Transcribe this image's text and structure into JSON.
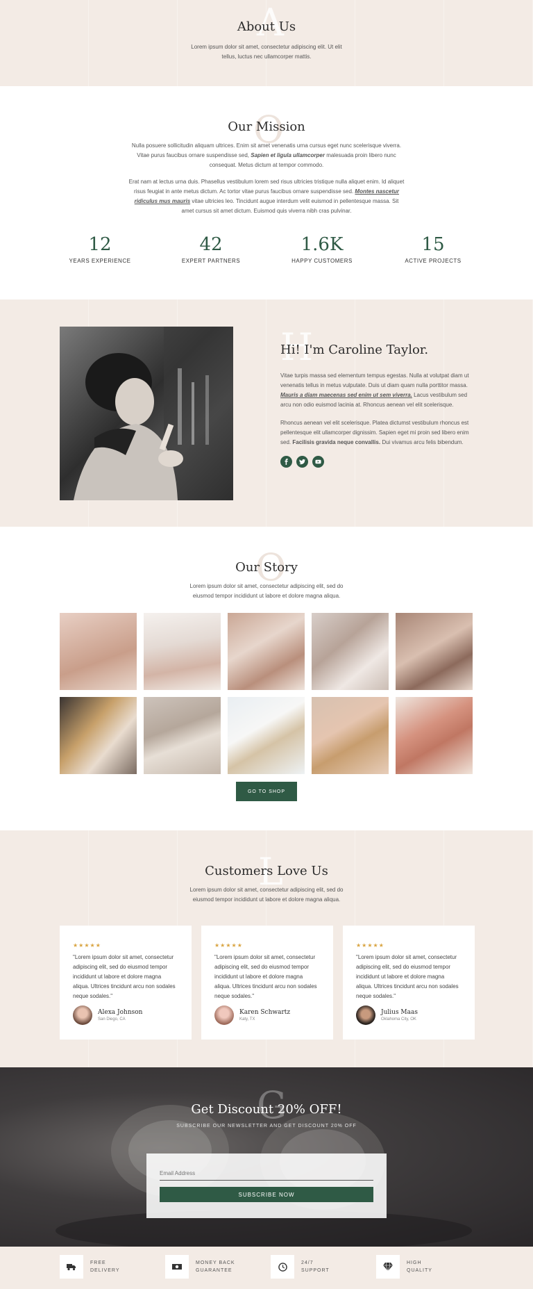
{
  "about": {
    "letter": "A",
    "title": "About Us",
    "text": "Lorem ipsum dolor sit amet, consectetur adipiscing elit. Ut elit tellus, luctus nec ullamcorper mattis."
  },
  "mission": {
    "letter": "O",
    "title": "Our Mission",
    "p1_a": "Nulla posuere sollicitudin aliquam ultrices. Enim sit amet venenatis urna cursus eget nunc scelerisque viverra. Vitae purus faucibus ornare suspendisse sed,",
    "p1_b": "Sapien et ligula ullamcorper",
    "p1_c": "malesuada proin libero nunc consequat. Metus dictum at tempor commodo.",
    "p2_a": "Erat nam at lectus urna duis. Phasellus vestibulum lorem sed risus ultricies tristique nulla aliquet enim. Id aliquet risus feugiat in ante metus dictum. Ac tortor vitae purus faucibus ornare suspendisse sed.",
    "p2_b": "Montes nascetur ridiculus mus mauris",
    "p2_c": "vitae ultricies leo. Tincidunt augue interdum velit euismod in pellentesque massa. Sit amet cursus sit amet dictum. Euismod quis viverra nibh cras pulvinar.",
    "stats": [
      {
        "value": "12",
        "label": "YEARS EXPERIENCE"
      },
      {
        "value": "42",
        "label": "EXPERT PARTNERS"
      },
      {
        "value": "1.6K",
        "label": "HAPPY CUSTOMERS"
      },
      {
        "value": "15",
        "label": "ACTIVE PROJECTS"
      }
    ]
  },
  "bio": {
    "letter": "H",
    "title": "Hi! I'm Caroline Taylor.",
    "p1_a": "Vitae turpis massa sed elementum tempus egestas. Nulla at volutpat diam ut venenatis tellus in metus vulputate. Duis ut diam quam nulla porttitor massa.",
    "p1_b": "Mauris a diam maecenas sed enim ut sem viverra.",
    "p1_c": "Lacus vestibulum sed arcu non odio euismod lacinia at. Rhoncus aenean vel elit scelerisque.",
    "p2_a": "Rhoncus aenean vel elit scelerisque. Platea dictumst vestibulum rhoncus est pellentesque elit ullamcorper dignissim. Sapien eget mi proin sed libero enim sed.",
    "p2_b": "Facilisis gravida neque convallis.",
    "p2_c": "Dui vivamus arcu felis bibendum.",
    "socials": [
      "facebook-icon",
      "twitter-icon",
      "youtube-icon"
    ]
  },
  "story": {
    "letter": "O",
    "title": "Our Story",
    "text": "Lorem ipsum dolor sit amet, consectetur adipiscing elit, sed do eiusmod tempor incididunt ut labore et dolore magna aliqua.",
    "button": "GO TO SHOP"
  },
  "reviews": {
    "letter": "L",
    "title": "Customers Love Us",
    "text": "Lorem ipsum dolor sit amet, consectetur adipiscing elit, sed do eiusmod tempor incididunt ut labore et dolore magna aliqua.",
    "stars": "★★★★★",
    "items": [
      {
        "quote": "\"Lorem ipsum dolor sit amet, consectetur adipiscing elit, sed do eiusmod tempor incididunt ut labore et dolore magna aliqua. Ultrices tincidunt arcu non sodales neque sodales.\"",
        "name": "Alexa Johnson",
        "loc": "San Diego, CA"
      },
      {
        "quote": "\"Lorem ipsum dolor sit amet, consectetur adipiscing elit, sed do eiusmod tempor incididunt ut labore et dolore magna aliqua. Ultrices tincidunt arcu non sodales neque sodales.\"",
        "name": "Karen Schwartz",
        "loc": "Katy, TX"
      },
      {
        "quote": "\"Lorem ipsum dolor sit amet, consectetur adipiscing elit, sed do eiusmod tempor incididunt ut labore et dolore magna aliqua. Ultrices tincidunt arcu non sodales neque sodales.\"",
        "name": "Julius Maas",
        "loc": "Oklahoma City, OK"
      }
    ]
  },
  "discount": {
    "letter": "G",
    "title": "Get Discount 20% OFF!",
    "subtitle": "SUBSCRIBE OUR NEWSLETTER AND GET DISCOUNT 20% OFF",
    "placeholder": "Email Address",
    "button": "SUBSCRIBE NOW"
  },
  "features": [
    {
      "icon": "truck-icon",
      "line1": "FREE",
      "line2": "DELIVERY"
    },
    {
      "icon": "money-icon",
      "line1": "MONEY BACK",
      "line2": "GUARANTEE"
    },
    {
      "icon": "clock-icon",
      "line1": "24/7",
      "line2": "SUPPORT"
    },
    {
      "icon": "diamond-icon",
      "line1": "HIGH",
      "line2": "QUALITY"
    }
  ],
  "colors": {
    "beige": "#f3ebe5",
    "green": "#2f5a45",
    "dark": "#2b2b2b"
  }
}
